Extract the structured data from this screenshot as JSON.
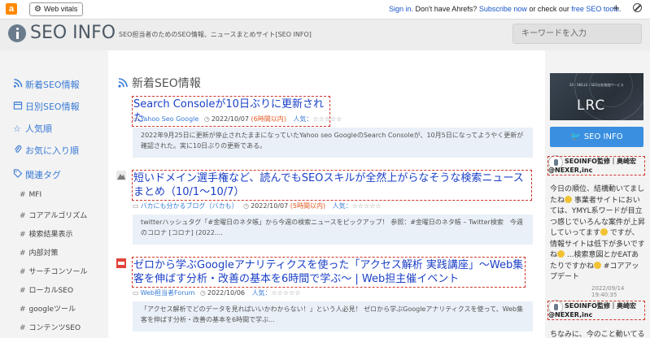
{
  "ahrefs": {
    "logo": "a",
    "web_vitals_label": "Web vitals",
    "signin": "Sign in.",
    "msg_mid": " Don't have Ahrefs? ",
    "subscribe": "Subscribe now",
    "msg_or": " or check our ",
    "free_tools": "free SEO tools",
    "msg_end": ".",
    "plus": "+"
  },
  "header": {
    "logo_text": "SEO INFO",
    "tagline": "SEO担当者のためのSEO情報、ニュースまとめサイト[SEO INFO]",
    "search_placeholder": "キーワードを入力"
  },
  "left_nav": {
    "items": [
      {
        "icon": "rss-icon",
        "label": "新着SEO情報"
      },
      {
        "icon": "calendar-icon",
        "label": "日別SEO情報"
      },
      {
        "icon": "star-icon",
        "label": "人気順"
      },
      {
        "icon": "paperclip-icon",
        "label": "お気に入り順"
      },
      {
        "icon": "tag-icon",
        "label": "関連タグ"
      }
    ],
    "tags": [
      "MFI",
      "コアアルゴリズム",
      "検索結果表示",
      "内部対策",
      "サーチコンソール",
      "ローカルSEO",
      "googleツール",
      "コンテンツSEO"
    ]
  },
  "main": {
    "section_title": "新着SEO情報",
    "articles": [
      {
        "title": "Search Consoleが10日ぶりに更新された",
        "source": "Yahoo Seo Google",
        "date": "2022/10/07",
        "days": "(6時間以内)",
        "popularity_label": "人気：",
        "stars": "☆☆☆☆☆",
        "excerpt": "2022年9月25日に更新が停止されたままになっていたYahoo seo GoogleのSearch Consoleが、10月5日になってようやく更新が確認された。実に10日ぶりの更新である。"
      },
      {
        "title": "短いドメイン選手権など、読んでもSEOスキルが全然上がらなそうな検索ニュースまとめ（10/1〜10/7）",
        "source": "バカにも分かるブログ（バカも）",
        "date": "2022/10/07",
        "days": "(5時間以内)",
        "popularity_label": "人気：",
        "stars": "☆☆☆☆☆",
        "excerpt": "twitterハッシュタグ「#金曜日のネタ帳」から今週の検索ニュースをピックアップ！ 参照：#金曜日のネタ帳 – Twitter検索　今週のコロナ [コロナ] (2022...."
      },
      {
        "title": "ゼロから学ぶGoogleアナリティクスを使った「アクセス解析 実践講座」～Web集客を伸ばす分析・改善の基本を6時間で学ぶ～ | Web担主催イベント",
        "source": "Web担当者Forum",
        "date": "2022/10/06",
        "days": "",
        "popularity_label": "人気：",
        "stars": "☆☆☆☆☆",
        "excerpt": "「アクセス解析でどのデータを見ればいいかわからない！」という人必見！ ゼロから学ぶGoogleアナリティクスを使って、Web集客を伸ばす分析・改善の基本を6時間で学ぶ..."
      }
    ]
  },
  "right": {
    "banner_sub": "20・SKILLS・SEO分析勉強サービス",
    "banner_text": "LRC",
    "twitter_label": "SEO INFO",
    "tweets": [
      {
        "author": "SEOINFO監修｜奥崎宏@NEXER,inc",
        "text_parts": [
          "今日の順位、結構動いてましたね",
          " 事業者サイトにおいては、YMYL系ワードが目立つ感じでいろんな案件が上昇していってます",
          " ですが、情報サイトは低下が多いですね",
          " ...検索意図とかEATあたりですかね",
          " #コアアップデート"
        ],
        "time": "2022/09/14 19:40:35"
      },
      {
        "author": "SEOINFO監修｜奥崎宏@NEXER,inc",
        "text": "ちなみに、今のこと動いてる"
      }
    ]
  }
}
